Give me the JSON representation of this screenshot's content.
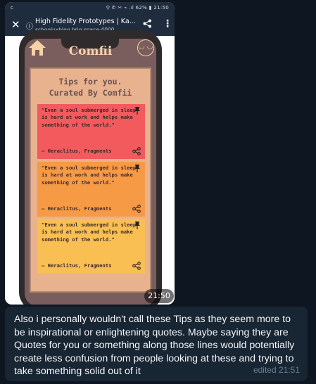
{
  "status_bar": {
    "left_glyph": "c",
    "right_text": "⚲ ✆ ✂ ⌁ .ıl 62% ▮ 21:50"
  },
  "browser": {
    "close_glyph": "✕",
    "info_glyph": "ⓘ",
    "title": "High Fidelity Prototypes | Ka...",
    "url": "schooluxblog.brig.space",
    "port": ":4000",
    "share_glyph": "⋞",
    "menu_glyph": "⋮"
  },
  "app": {
    "brand": "Comfii",
    "smile_glyph": "◡ ◡",
    "title_line1": "Tips for you.",
    "title_line2": "Curated By Comfii",
    "cards": [
      {
        "quote": "\"Even a soul submerged in sleep is hard at work and helps make something of the world.\"",
        "author": "– Heraclitus, Fragments",
        "color": "#f25a5e"
      },
      {
        "quote": "\"Even a soul submerged in sleep is hard at work and helps make something of the world.\"",
        "author": "– Heraclitus, Fragments",
        "color": "#f79a46"
      },
      {
        "quote": "\"Even a soul submerged in sleep is hard at work and helps make something of the world.\"",
        "author": "– Heraclitus, Fragments",
        "color": "#f9bf52"
      }
    ]
  },
  "media_time": "21:50",
  "message": {
    "text": "Also i personally wouldn't call these Tips as they seem more to be inspirational or enlightening quotes. Maybe saying they are Quotes for you or something along those lines would potentially create less confusion from people looking at these and trying to take something solid out of it",
    "edited_label": "edited 21:51"
  },
  "colors": {
    "chat_bg": "#0e1621",
    "bubble_bg": "#182533",
    "screen_bg": "#7a5e5d",
    "panel_bg": "#e8b28e",
    "brand_color": "#f7d2a6"
  },
  "icons": [
    "home-icon",
    "smile-icon",
    "pin-icon",
    "share-icon",
    "close-icon",
    "info-icon",
    "menu-icon"
  ]
}
